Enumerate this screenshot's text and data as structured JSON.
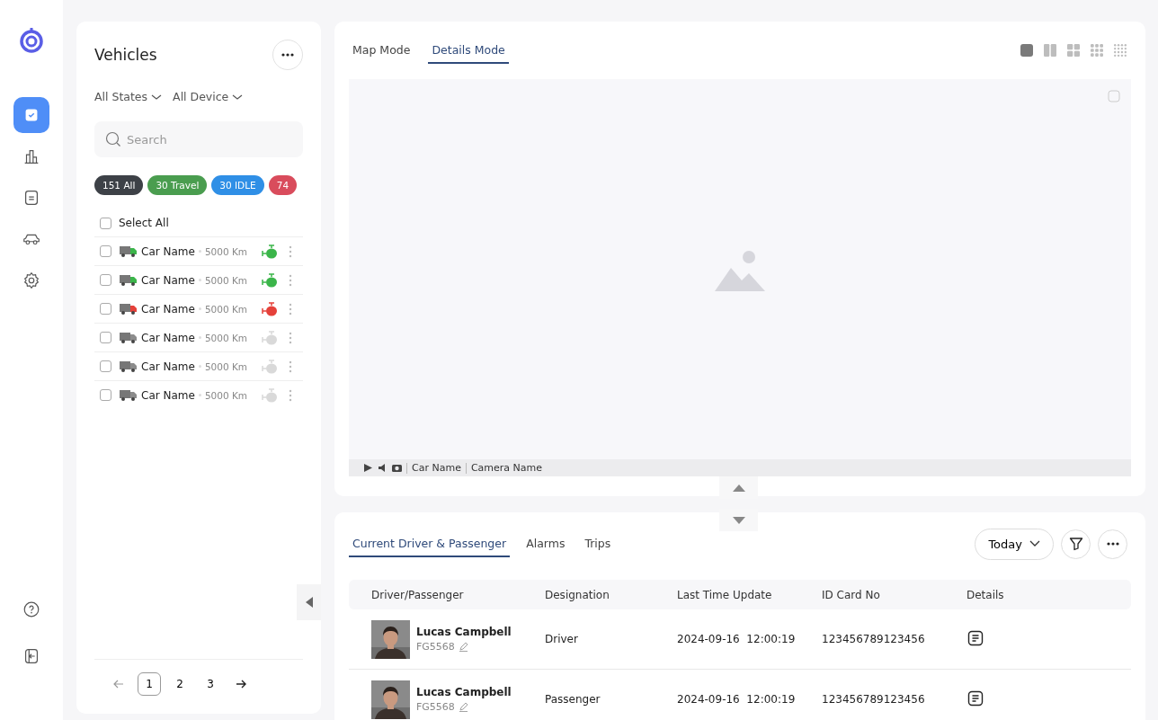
{
  "rail": {
    "items": [
      {
        "kind": "check",
        "selected": true
      },
      {
        "kind": "chart",
        "selected": false
      },
      {
        "kind": "document",
        "selected": false
      },
      {
        "kind": "car",
        "selected": false
      },
      {
        "kind": "gear",
        "selected": false
      }
    ],
    "bottom": [
      {
        "kind": "help"
      },
      {
        "kind": "logout"
      }
    ]
  },
  "vehicles": {
    "title": "Vehicles",
    "filters": [
      "All States",
      "All Device"
    ],
    "search": {
      "placeholder": "Search"
    },
    "chips": [
      {
        "label": "151 All",
        "color": "#3d4147"
      },
      {
        "label": "30 Travel",
        "color": "#4a9d4f"
      },
      {
        "label": "30 IDLE",
        "color": "#2f8fe6"
      },
      {
        "label": "74",
        "color": "#d94c5c"
      }
    ],
    "select_all": {
      "label": "Select All",
      "checked": false
    },
    "rows": [
      {
        "name": "Car Name",
        "distance": "5000 Km",
        "checked": false,
        "kind": "on"
      },
      {
        "name": "Car Name",
        "distance": "5000 Km",
        "checked": false,
        "kind": "on"
      },
      {
        "name": "Car Name",
        "distance": "5000 Km",
        "checked": false,
        "kind": "off"
      },
      {
        "name": "Car Name",
        "distance": "5000 Km",
        "checked": false,
        "kind": "none"
      },
      {
        "name": "Car Name",
        "distance": "5000 Km",
        "checked": false,
        "kind": "none"
      },
      {
        "name": "Car Name",
        "distance": "5000 Km",
        "checked": false,
        "kind": "none"
      }
    ],
    "pager": {
      "pages": [
        {
          "label": "1",
          "selected": true
        },
        {
          "label": "2",
          "selected": false
        },
        {
          "label": "3",
          "selected": false
        }
      ]
    }
  },
  "viewer": {
    "tabs": [
      {
        "label": "Map Mode",
        "selected": false
      },
      {
        "label": "Details Mode",
        "selected": true
      }
    ],
    "layouts": [
      {
        "kind": "single",
        "selected": true
      },
      {
        "kind": "double",
        "selected": false
      },
      {
        "kind": "quad",
        "selected": false
      },
      {
        "kind": "nine",
        "selected": false
      },
      {
        "kind": "sixteen",
        "selected": false
      }
    ],
    "video": {
      "car": "Car Name",
      "camera": "Camera Name"
    }
  },
  "details": {
    "tabs": [
      {
        "label": "Current Driver & Passenger",
        "selected": true
      },
      {
        "label": "Alarms",
        "selected": false
      },
      {
        "label": "Trips",
        "selected": false
      }
    ],
    "period": "Today",
    "columns": [
      "Driver/Passenger",
      "Designation",
      "Last Time Update",
      "ID Card No",
      "Details"
    ],
    "rows": [
      {
        "name": "Lucas Campbell",
        "code": "FG5568",
        "designation": "Driver",
        "updated": "2024-09-16  12:00:19",
        "id_card": "123456789123456"
      },
      {
        "name": "Lucas Campbell",
        "code": "FG5568",
        "designation": "Passenger",
        "updated": "2024-09-16  12:00:19",
        "id_card": "123456789123456"
      }
    ]
  }
}
